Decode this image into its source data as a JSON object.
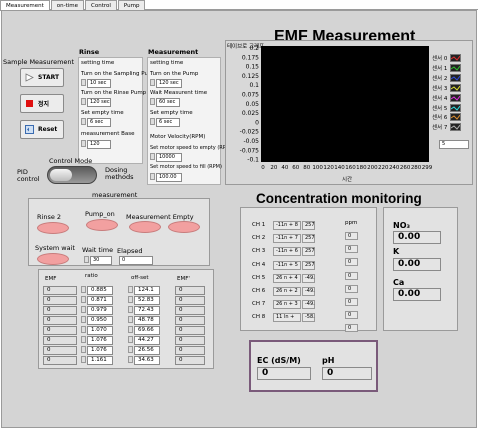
{
  "tabs": [
    "Measurement",
    "on-time",
    "Control",
    "Pump"
  ],
  "sample": {
    "heading": "Sample Measurement",
    "start_label": "START",
    "stop_label": "정지",
    "reset_label": "Reset"
  },
  "rinse": {
    "heading": "Rinse",
    "setting_time": "setting time",
    "sampling_pump_label": "Turn on the Sampling Pump",
    "sampling_pump_value": "10 sec",
    "rinse_pump_label": "Turn on the Rinse Pump",
    "rinse_pump_value": "120 sec",
    "empty_time_label": "Set empty time",
    "empty_time_value": "6 sec",
    "measurement_base_label": "measurement Base",
    "measurement_base_value": "120"
  },
  "measurement_settings": {
    "heading": "Measurement",
    "setting_time": "setting time",
    "pump_label": "Turn on the Pump",
    "pump_value": "120 sec",
    "wait_label": "Wait Measurent time",
    "wait_value": "60 sec",
    "empty_label": "Set empty time",
    "empty_value": "6 sec",
    "velocity_label": "Motor Velocity(RPM)",
    "speed_empty_label": "Set motor speed to empty (RPM)",
    "speed_empty_value": "10000",
    "speed_fill_label": "Set motor speed to fill (RPM)",
    "speed_fill_value": "100.00"
  },
  "control_mode": {
    "heading": "Control Mode",
    "left_label": "PID control",
    "right_label": "Dosing methods"
  },
  "status": {
    "heading": "measurement",
    "rinse2": "Rinse 2",
    "pump_on": "Pump_on",
    "measurement_empty": "Measurement Empty",
    "system_wait": "System wait",
    "wait_time_label": "Wait time",
    "wait_time_value": "30",
    "elapsed_label": "Elapsed",
    "elapsed_value": "0"
  },
  "table": {
    "headers": [
      "EMF",
      "ratio",
      "off-set",
      "EMF'"
    ],
    "emf": [
      "0",
      "0",
      "0",
      "0",
      "0",
      "0",
      "0",
      "0"
    ],
    "ratio": [
      "0.885",
      "0.871",
      "0.979",
      "0.950",
      "1.070",
      "1.076",
      "1.076",
      "1.161"
    ],
    "offset": [
      "124.1",
      "52.83",
      "72.43",
      "48.78",
      "69.66",
      "44.27",
      "26.56",
      "34.63"
    ],
    "emf_prime": [
      "0",
      "0",
      "0",
      "0",
      "0",
      "0",
      "0",
      "0"
    ]
  },
  "emf_chart": {
    "side_label": "테이브로 그래프",
    "title": "EMF Measurement",
    "xlabel": "시간",
    "small_field_value": "5",
    "legend": [
      "센서 0",
      "센서 1",
      "센서 2",
      "센서 3",
      "센서 4",
      "센서 5",
      "센서 6",
      "센서 7"
    ]
  },
  "chart_data": {
    "type": "line",
    "title": "EMF Measurement",
    "xlabel": "시간",
    "ylabel": "",
    "xlim": [
      0,
      299
    ],
    "ylim": [
      -0.2,
      0.2
    ],
    "x_ticks": [
      "0",
      "20",
      "40",
      "60",
      "80",
      "100",
      "120",
      "140",
      "160",
      "180",
      "200",
      "220",
      "240",
      "260",
      "280",
      "299"
    ],
    "y_ticks": [
      "0.2",
      "0.175",
      "0.15",
      "0.125",
      "0.1",
      "0.075",
      "0.05",
      "0.025",
      "0",
      "-0.025",
      "-0.05",
      "-0.075",
      "-0.1"
    ],
    "series": [
      {
        "name": "센서 0",
        "values": []
      },
      {
        "name": "센서 1",
        "values": []
      },
      {
        "name": "센서 2",
        "values": []
      },
      {
        "name": "센서 3",
        "values": []
      },
      {
        "name": "센서 4",
        "values": []
      },
      {
        "name": "센서 5",
        "values": []
      },
      {
        "name": "센서 6",
        "values": []
      },
      {
        "name": "센서 7",
        "values": []
      }
    ],
    "grid": false
  },
  "concentration": {
    "title": "Concentration monitoring",
    "ppm_label": "ppm",
    "channels": [
      {
        "label": "CH 1",
        "eq": "-11n + 8",
        "val": "257"
      },
      {
        "label": "CH 2",
        "eq": "-11n + 7",
        "val": "257"
      },
      {
        "label": "CH 3",
        "eq": "-11n + 6",
        "val": "257"
      },
      {
        "label": "CH 4",
        "eq": "-11n + 5",
        "val": "257"
      },
      {
        "label": "CH 5",
        "eq": "26 n + 4",
        "val": "-49."
      },
      {
        "label": "CH 6",
        "eq": "26 n + 2",
        "val": "-49."
      },
      {
        "label": "CH 7",
        "eq": "26 n + 3",
        "val": "-49."
      },
      {
        "label": "CH 8",
        "eq": "11  ln +",
        "val": "-58."
      }
    ],
    "ppm": [
      "0",
      "0",
      "0",
      "0",
      "0",
      "0",
      "0",
      "0"
    ],
    "no3_label": "NO₃",
    "no3_value": "0.00",
    "k_label": "K",
    "k_value": "0.00",
    "ca_label": "Ca",
    "ca_value": "0.00",
    "ec_label": "EC (dS/M)",
    "ec_value": "0",
    "ph_label": "pH",
    "ph_value": "0"
  },
  "colors": {
    "led_red": "#f2a0a0",
    "panel_gray": "#d4d4d4",
    "chart_bg": "#000000"
  }
}
